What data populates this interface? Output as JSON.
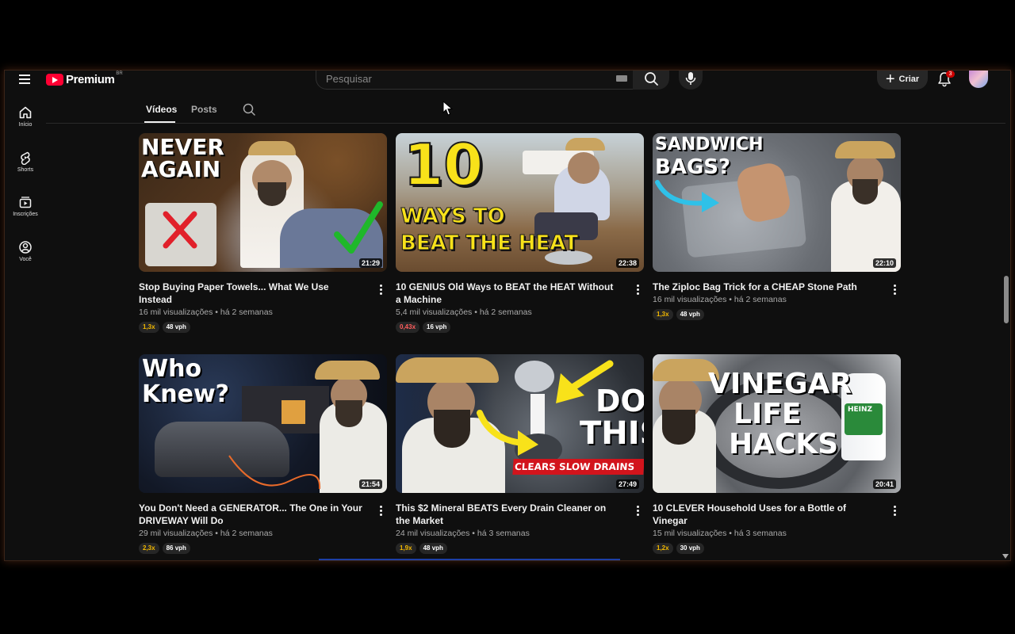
{
  "masthead": {
    "logo_text": "Premium",
    "logo_region": "BR",
    "search_placeholder": "Pesquisar",
    "create_label": "Criar",
    "notification_count": "3"
  },
  "guide": {
    "items": [
      {
        "label": "Início",
        "icon": "home-icon"
      },
      {
        "label": "Shorts",
        "icon": "shorts-icon"
      },
      {
        "label": "Inscrições",
        "icon": "subscriptions-icon"
      },
      {
        "label": "Você",
        "icon": "you-icon"
      }
    ]
  },
  "tabs": {
    "videos": "Vídeos",
    "posts": "Posts",
    "active": "videos"
  },
  "videos": [
    {
      "title": "Stop Buying Paper Towels... What We Use Instead",
      "views": "16 mil visualizações",
      "age": "há 2 semanas",
      "duration": "21:29",
      "multiplier": "1,3x",
      "vph": "48 vph",
      "thumb_text": [
        "NEVER",
        "AGAIN"
      ]
    },
    {
      "title": "10 GENIUS Old Ways to BEAT the HEAT Without a Machine",
      "views": "5,4 mil visualizações",
      "age": "há 2 semanas",
      "duration": "22:38",
      "multiplier": "0,43x",
      "vph": "16 vph",
      "thumb_text": [
        "10",
        "WAYS TO",
        "BEAT THE HEAT"
      ]
    },
    {
      "title": "The Ziploc Bag Trick for a CHEAP Stone Path",
      "views": "16 mil visualizações",
      "age": "há 2 semanas",
      "duration": "22:10",
      "multiplier": "1,3x",
      "vph": "48 vph",
      "thumb_text": [
        "SANDWICH",
        "BAGS?"
      ]
    },
    {
      "title": "You Don't Need a GENERATOR... The One in Your DRIVEWAY Will Do",
      "views": "29 mil visualizações",
      "age": "há 2 semanas",
      "duration": "21:54",
      "multiplier": "2,3x",
      "vph": "86 vph",
      "thumb_text": [
        "Who",
        "Knew?"
      ]
    },
    {
      "title": "This $2 Mineral BEATS Every Drain Cleaner on the Market",
      "views": "24 mil visualizações",
      "age": "há 3 semanas",
      "duration": "27:49",
      "multiplier": "1,9x",
      "vph": "48 vph",
      "thumb_text": [
        "DO",
        "THIS",
        "CLEARS SLOW DRAINS"
      ]
    },
    {
      "title": "10 CLEVER Household Uses for a Bottle of Vinegar",
      "views": "15 mil visualizações",
      "age": "há 3 semanas",
      "duration": "20:41",
      "multiplier": "1,2x",
      "vph": "30 vph",
      "thumb_text": [
        "VINEGAR",
        "LIFE",
        "HACKS",
        "HEINZ"
      ]
    }
  ]
}
